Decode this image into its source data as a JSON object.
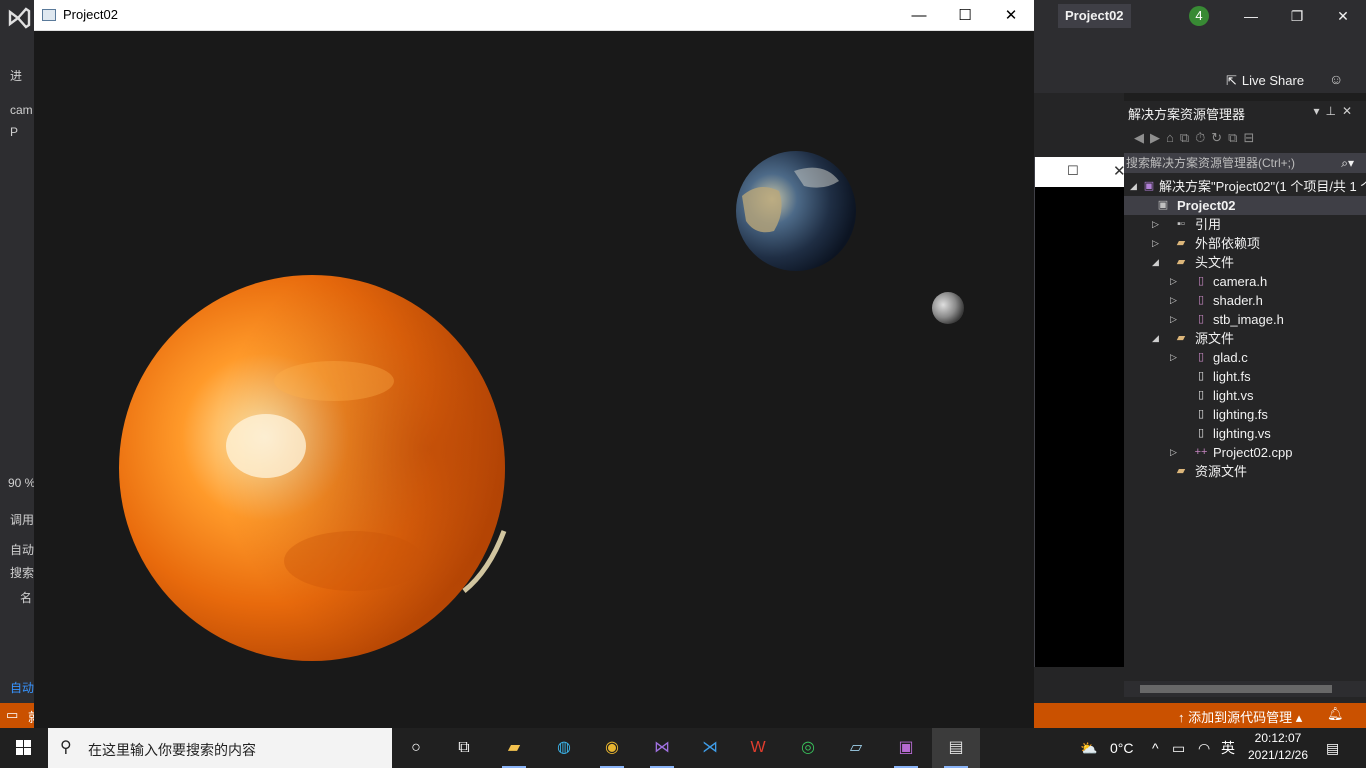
{
  "vs": {
    "title": "Project02",
    "notification_count": "4",
    "live_share": "Live Share",
    "left_strip": [
      "进",
      "cam",
      "P",
      "90 %",
      "调用",
      "自动",
      "搜索",
      "名",
      "自动"
    ],
    "status_source_control": "添加到源代码管理",
    "status_left": "就"
  },
  "solution_explorer": {
    "title": "解决方案资源管理器",
    "search_placeholder": "搜索解决方案资源管理器(Ctrl+;)",
    "items": [
      {
        "label": "解决方案\"Project02\"(1 个项目/共 1 个)",
        "icon": "solution-icon"
      },
      {
        "label": "Project02",
        "icon": "project-icon",
        "selected": true
      },
      {
        "label": "引用",
        "icon": "references-icon"
      },
      {
        "label": "外部依赖项",
        "icon": "folder-icon"
      },
      {
        "label": "头文件",
        "icon": "folder-open-icon"
      },
      {
        "label": "camera.h",
        "icon": "header-file-icon"
      },
      {
        "label": "shader.h",
        "icon": "header-file-icon"
      },
      {
        "label": "stb_image.h",
        "icon": "header-file-icon"
      },
      {
        "label": "源文件",
        "icon": "folder-open-icon"
      },
      {
        "label": "glad.c",
        "icon": "file-icon"
      },
      {
        "label": "light.fs",
        "icon": "file-icon"
      },
      {
        "label": "light.vs",
        "icon": "file-icon"
      },
      {
        "label": "lighting.fs",
        "icon": "file-icon"
      },
      {
        "label": "lighting.vs",
        "icon": "file-icon"
      },
      {
        "label": "Project02.cpp",
        "icon": "cpp-file-icon"
      },
      {
        "label": "资源文件",
        "icon": "folder-icon"
      }
    ]
  },
  "gl_window": {
    "title": "Project02"
  },
  "taskbar": {
    "search_placeholder": "在这里输入你要搜索的内容",
    "apps": [
      "cortana-icon",
      "task-view-icon",
      "file-explorer-icon",
      "edge-icon",
      "chrome-icon",
      "visual-studio-icon",
      "vscode-icon",
      "wps-icon",
      "wechat-icon",
      "notes-icon",
      "terminal-icon",
      "app-window-icon"
    ],
    "weather": "0°C",
    "ime": "英",
    "time": "20:12:07",
    "date": "2021/12/26"
  },
  "colors": {
    "vs_accent": "#ca5100",
    "vs_dark": "#2d2d30",
    "taskbar": "#202020"
  }
}
